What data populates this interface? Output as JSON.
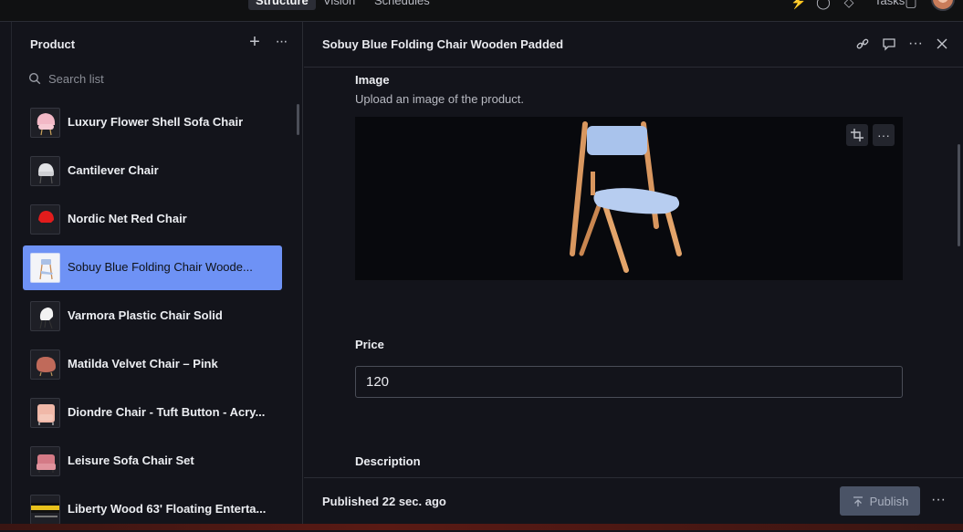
{
  "topbar": {
    "tabs": [
      {
        "label": "Structure"
      },
      {
        "label": "Vision"
      },
      {
        "label": "Schedules"
      }
    ],
    "tasks_label": "Tasks"
  },
  "list": {
    "title": "Product",
    "search_placeholder": "Search list",
    "items": [
      {
        "label": "Luxury Flower Shell Sofa Chair"
      },
      {
        "label": "Cantilever Chair"
      },
      {
        "label": "Nordic Net Red Chair"
      },
      {
        "label": "Sobuy Blue Folding Chair Woode..."
      },
      {
        "label": "Varmora Plastic Chair Solid"
      },
      {
        "label": "Matilda Velvet Chair – Pink"
      },
      {
        "label": "Diondre Chair - Tuft Button - Acry..."
      },
      {
        "label": "Leisure Sofa Chair Set"
      },
      {
        "label": "Liberty Wood 63' Floating Enterta..."
      }
    ],
    "selected_index": 3
  },
  "document": {
    "title": "Sobuy Blue Folding Chair Wooden Padded",
    "image_label": "Image",
    "image_description": "Upload an image of the product.",
    "price_label": "Price",
    "price_value": "120",
    "description_label": "Description"
  },
  "footer": {
    "status_prefix": "Published",
    "status_time": "22 sec. ago",
    "publish_label": "Publish"
  },
  "colors": {
    "accent": "#6e92f5",
    "background": "#13141b",
    "publish_bg": "#4a5366"
  }
}
